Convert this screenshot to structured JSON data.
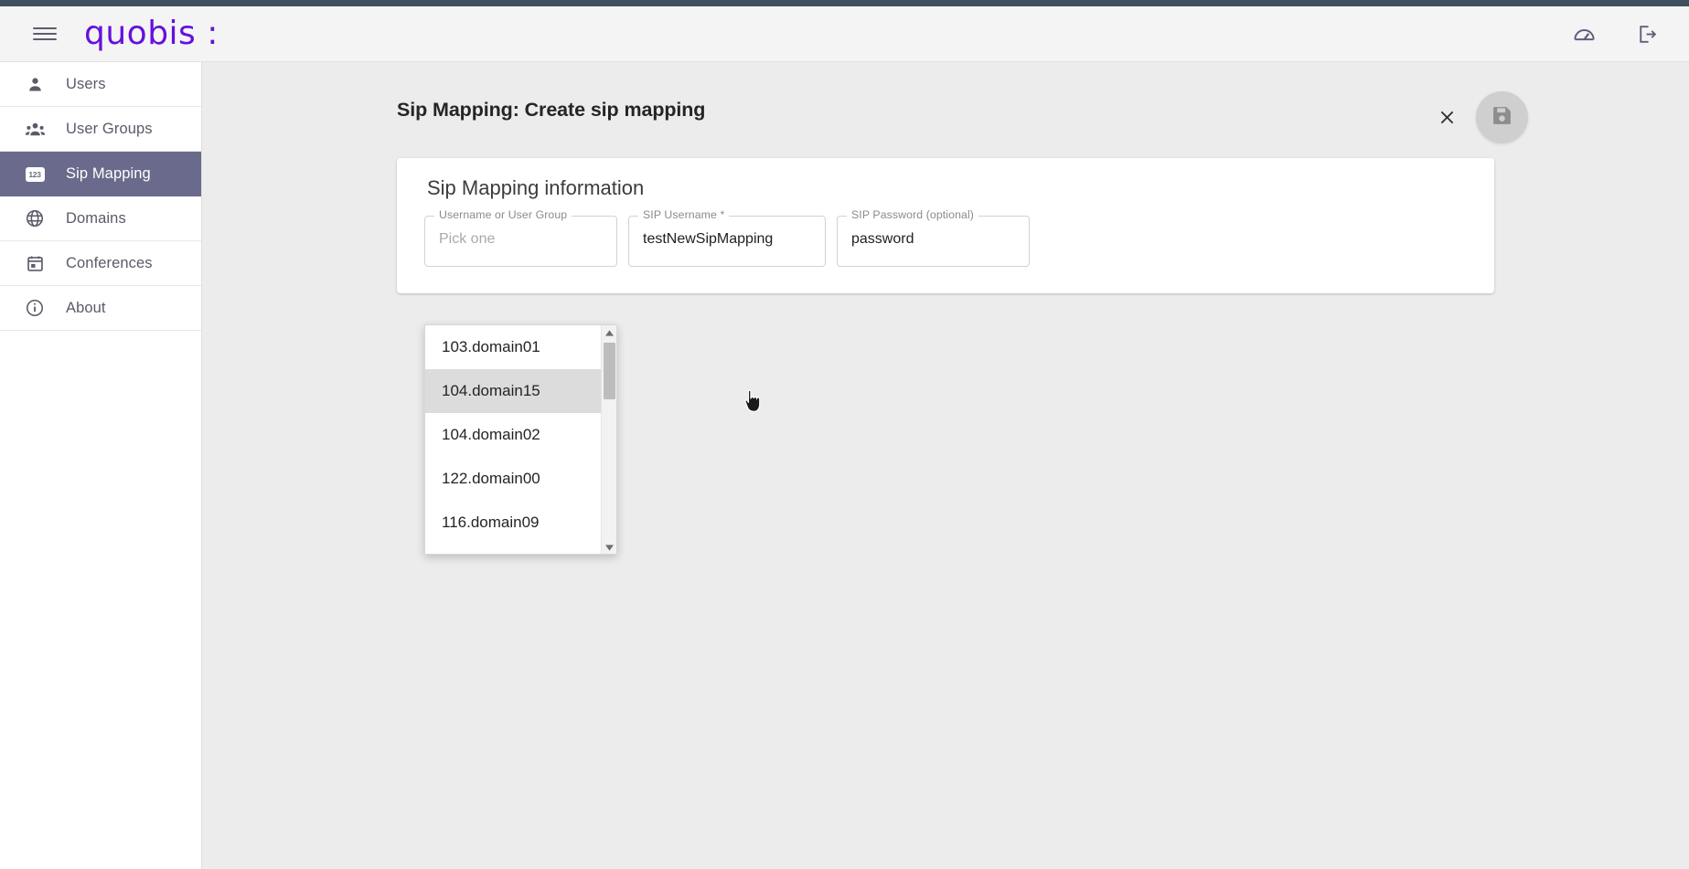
{
  "app": {
    "logo_text": "quobis :",
    "menu_icon": "hamburger-menu-icon",
    "dashboard_icon": "speedometer-icon",
    "logout_icon": "logout-icon"
  },
  "sidebar": {
    "items": [
      {
        "label": "Users",
        "icon": "person-icon",
        "active": false
      },
      {
        "label": "User Groups",
        "icon": "people-icon",
        "active": false
      },
      {
        "label": "Sip Mapping",
        "icon": "123-badge-icon",
        "active": true
      },
      {
        "label": "Domains",
        "icon": "globe-icon",
        "active": false
      },
      {
        "label": "Conferences",
        "icon": "calendar-icon",
        "active": false
      },
      {
        "label": "About",
        "icon": "info-icon",
        "active": false
      }
    ]
  },
  "page": {
    "title": "Sip Mapping: Create sip mapping",
    "close_label": "×",
    "close_icon": "close-icon",
    "save_icon": "save-floppy-icon"
  },
  "card": {
    "title": "Sip Mapping information",
    "fields": [
      {
        "label": "Username or User Group",
        "value": "",
        "placeholder": "Pick one",
        "is_placeholder": true
      },
      {
        "label": "SIP Username *",
        "value": "testNewSipMapping",
        "placeholder": "",
        "is_placeholder": false
      },
      {
        "label": "SIP Password (optional)",
        "value": "password",
        "placeholder": "",
        "is_placeholder": false
      }
    ]
  },
  "dropdown": {
    "open": true,
    "highlighted_index": 1,
    "options": [
      "103.domain01",
      "104.domain15",
      "104.domain02",
      "122.domain00",
      "116.domain09"
    ],
    "scroll_up_icon": "triangle-up-icon",
    "scroll_down_icon": "triangle-down-icon"
  },
  "colors": {
    "brand_purple": "#6610dd",
    "sidebar_active": "#6a6a8c",
    "top_strip": "#3e5060",
    "content_bg": "#ececec"
  }
}
